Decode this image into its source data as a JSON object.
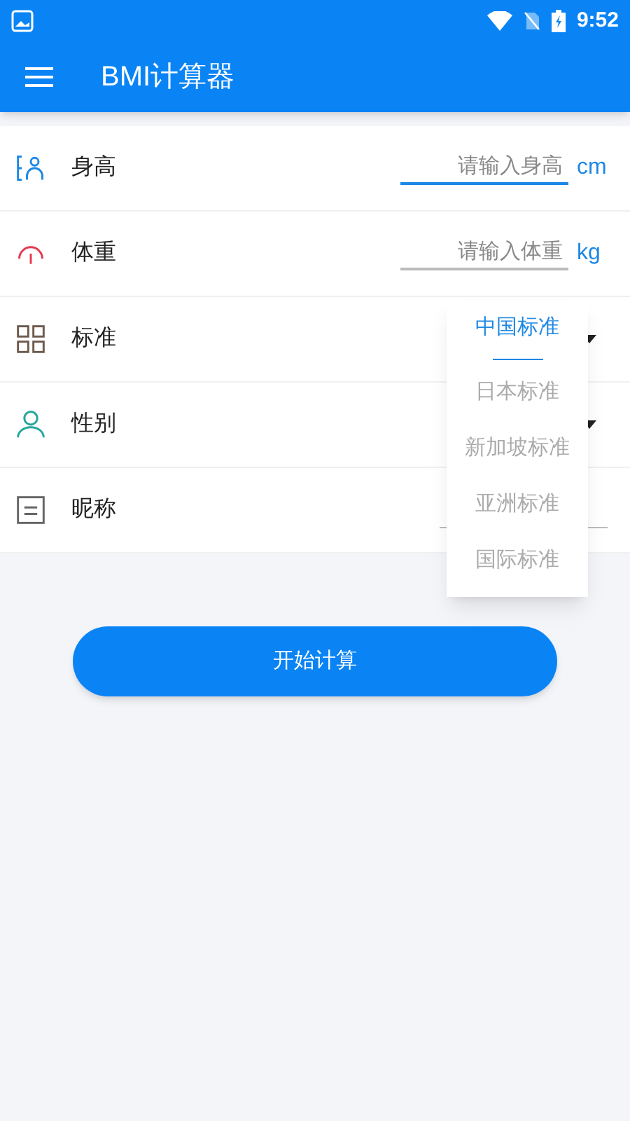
{
  "status_bar": {
    "time": "9:52"
  },
  "app_bar": {
    "title": "BMI计算器"
  },
  "rows": [
    {
      "kind": "input",
      "label": "身高",
      "placeholder": "请输入身高",
      "unit": "cm",
      "focused": true
    },
    {
      "kind": "input",
      "label": "体重",
      "placeholder": "请输入体重",
      "unit": "kg",
      "focused": false
    },
    {
      "kind": "select",
      "label": "标准"
    },
    {
      "kind": "select",
      "label": "性别"
    },
    {
      "kind": "text",
      "label": "昵称"
    }
  ],
  "dropdown": {
    "options": [
      {
        "label": "中国标准",
        "selected": true
      },
      {
        "label": "日本标准",
        "selected": false
      },
      {
        "label": "新加坡标准",
        "selected": false
      },
      {
        "label": "亚洲标准",
        "selected": false
      },
      {
        "label": "国际标准",
        "selected": false
      }
    ]
  },
  "button": {
    "label": "开始计算"
  }
}
